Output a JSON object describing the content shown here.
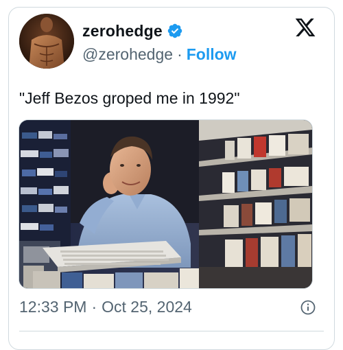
{
  "author": {
    "display_name": "zerohedge",
    "handle": "@zerohedge",
    "separator": "·",
    "follow_label": "Follow",
    "verified": true
  },
  "tweet": {
    "text": "\"Jeff Bezos groped me in 1992\""
  },
  "meta": {
    "time": "12:33 PM",
    "separator": "·",
    "date": "Oct 25, 2024"
  },
  "icons": {
    "brand": "x-logo-icon",
    "verified": "verified-badge-icon",
    "info": "info-icon"
  },
  "colors": {
    "accent": "#1d9bf0",
    "text_primary": "#0f1419",
    "text_secondary": "#536471",
    "border": "#cfd9de"
  }
}
